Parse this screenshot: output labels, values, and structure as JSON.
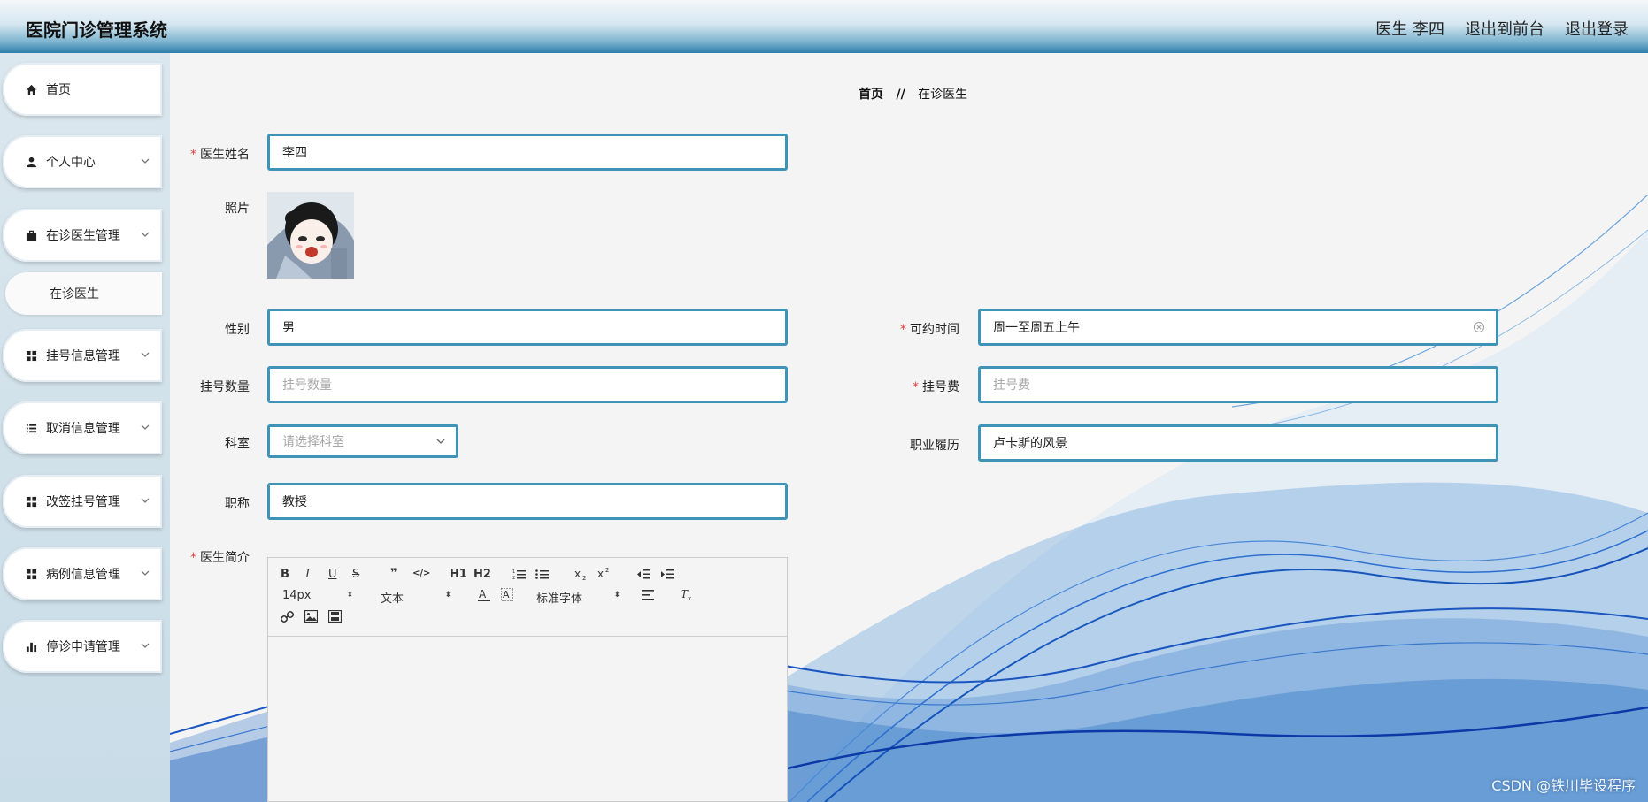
{
  "header": {
    "app_title": "医院门诊管理系统",
    "user_label": "医生 李四",
    "front_link": "退出到前台",
    "logout_link": "退出登录"
  },
  "sidebar": {
    "items": [
      {
        "label": "首页",
        "icon": "home-icon"
      },
      {
        "label": "个人中心",
        "icon": "user-icon"
      },
      {
        "label": "在诊医生管理",
        "icon": "briefcase-icon"
      },
      {
        "label": "挂号信息管理",
        "icon": "grid-icon"
      },
      {
        "label": "取消信息管理",
        "icon": "list-icon"
      },
      {
        "label": "改签挂号管理",
        "icon": "grid-icon"
      },
      {
        "label": "病例信息管理",
        "icon": "grid-icon"
      },
      {
        "label": "停诊申请管理",
        "icon": "bar-chart-icon"
      }
    ],
    "sub_item": "在诊医生"
  },
  "breadcrumb": {
    "home": "首页",
    "separator": "//",
    "current": "在诊医生"
  },
  "form": {
    "doctor_name": {
      "label": "医生姓名",
      "value": "李四"
    },
    "photo": {
      "label": "照片"
    },
    "gender": {
      "label": "性别",
      "value": "男"
    },
    "available_time": {
      "label": "可约时间",
      "value": "周一至周五上午"
    },
    "reg_count": {
      "label": "挂号数量",
      "placeholder": "挂号数量"
    },
    "reg_fee": {
      "label": "挂号费",
      "placeholder": "挂号费"
    },
    "department": {
      "label": "科室",
      "placeholder": "请选择科室"
    },
    "career": {
      "label": "职业履历",
      "value": "卢卡斯的风景"
    },
    "title": {
      "label": "职称",
      "value": "教授"
    },
    "intro": {
      "label": "医生简介"
    }
  },
  "editor": {
    "font_size": "14px",
    "block_type": "文本",
    "font_family": "标准字体",
    "buttons": [
      "B",
      "I",
      "U",
      "S",
      "❞",
      "</>",
      "H1",
      "H2"
    ]
  },
  "watermark": "CSDN @铁川毕设程序",
  "colors": {
    "accent": "#3f93b7",
    "header_dark": "#2d7ea9",
    "required": "#e0403c"
  }
}
